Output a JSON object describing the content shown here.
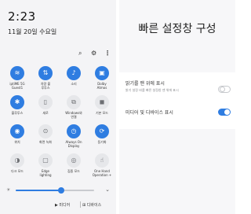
{
  "status": {
    "time": "2:23",
    "date": "11월 20일 수요일"
  },
  "top_icons": {
    "search": "⌕",
    "settings": "⚙",
    "more": "⋮"
  },
  "tiles": [
    {
      "label": "iptiME 5G\nGuest1",
      "glyph": "≋",
      "on": true,
      "icon": "wifi-icon"
    },
    {
      "label": "차량 블\n루투스",
      "glyph": "⇅",
      "on": true,
      "icon": "bluetooth-icon"
    },
    {
      "label": "소리",
      "glyph": "♪",
      "on": true,
      "icon": "sound-icon"
    },
    {
      "label": "Dolby\nAtmos",
      "glyph": "▣",
      "on": true,
      "icon": "dolby-icon"
    },
    {
      "label": "블루투스",
      "glyph": "✱",
      "on": true,
      "icon": "bluetooth-toggle-icon"
    },
    {
      "label": "세로",
      "glyph": "▯",
      "on": false,
      "icon": "rotation-icon"
    },
    {
      "label": "Windows와\n연결",
      "glyph": "⧉",
      "on": false,
      "icon": "link-windows-icon"
    },
    {
      "label": "기본 모드",
      "glyph": "◼",
      "on": false,
      "icon": "mode-icon"
    },
    {
      "label": "위치",
      "glyph": "◉",
      "on": true,
      "icon": "location-icon"
    },
    {
      "label": "화면 녹화",
      "glyph": "⊙",
      "on": false,
      "icon": "screen-record-icon"
    },
    {
      "label": "Always On\nDisplay",
      "glyph": "◷",
      "on": true,
      "icon": "aod-icon"
    },
    {
      "label": "동기화",
      "glyph": "⟳",
      "on": true,
      "icon": "sync-icon"
    },
    {
      "label": "다크 모드",
      "glyph": "◑",
      "on": false,
      "icon": "dark-mode-icon"
    },
    {
      "label": "Edge\nlighting",
      "glyph": "▢",
      "on": false,
      "icon": "edge-lighting-icon"
    },
    {
      "label": "집중 모드",
      "glyph": "◎",
      "on": false,
      "icon": "focus-mode-icon"
    },
    {
      "label": "One Hand\nOperation +",
      "glyph": "☝",
      "on": false,
      "icon": "one-hand-icon"
    }
  ],
  "brightness": {
    "level": 0.58,
    "sun": "☀",
    "chevron": "⌄"
  },
  "bottom_bar": {
    "media_label": "▶ 미디어",
    "devices_label": "⊞ 디바이스"
  },
  "settings_panel": {
    "title": "빠른 설정창 구성",
    "row1_title": "밝기를 맨 위에 표시",
    "row1_subtitle": "밝기 설정 바를 빠른 설정창 맨 위에 표시",
    "row1_enabled": false,
    "row2_title": "미디어 및 디바이스 표시",
    "row2_enabled": true
  },
  "colors": {
    "accent": "#2f7de1",
    "tile_off": "#e6e7ea"
  }
}
